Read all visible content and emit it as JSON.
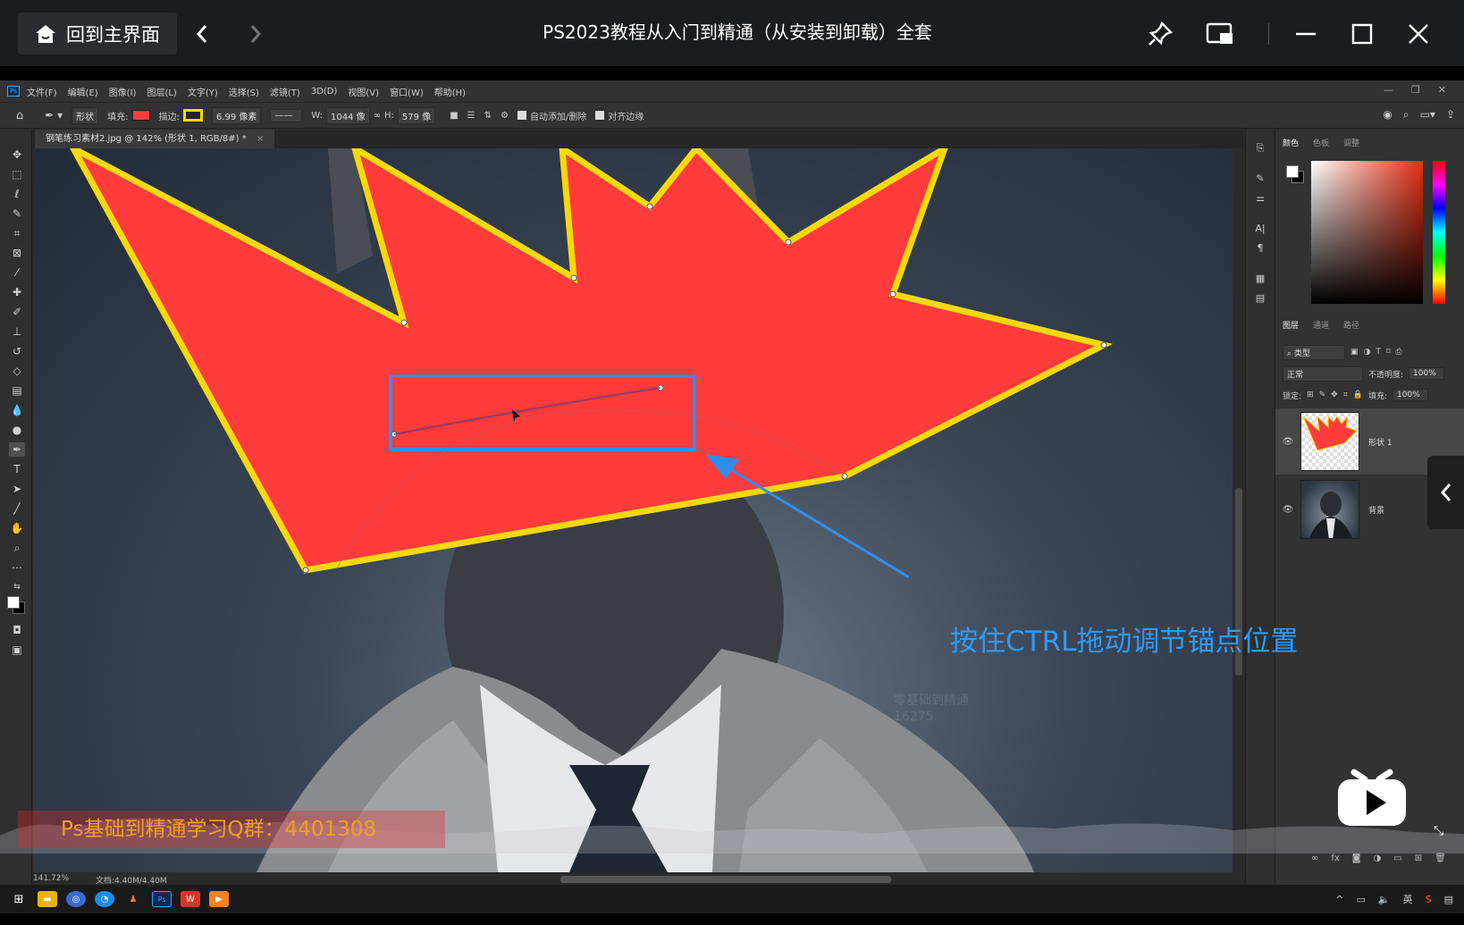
{
  "player": {
    "home_label": "回到主界面",
    "title": "PS2023教程从入门到精通（从安装到卸载）全套"
  },
  "ps": {
    "menu": [
      "文件(F)",
      "编辑(E)",
      "图像(I)",
      "图层(L)",
      "文字(Y)",
      "选择(S)",
      "滤镜(T)",
      "3D(D)",
      "视图(V)",
      "窗口(W)",
      "帮助(H)"
    ],
    "options": {
      "mode": "形状",
      "fill_label": "填充:",
      "stroke_label": "描边:",
      "stroke_width": "6.99 像素",
      "w_label": "W:",
      "w_value": "1044 像",
      "h_label": "H:",
      "h_value": "579 像",
      "auto_add_label": "自动添加/删除",
      "align_edges_label": "对齐边缘"
    },
    "doc_tab": "钢笔练习素材2.jpg @ 142% (形状 1, RGB/8#) *",
    "status": {
      "zoom": "141.72%",
      "doc": "文档:4.40M/4.40M"
    },
    "color_panel_tabs": [
      "颜色",
      "色板",
      "调整"
    ],
    "layers_panel_tabs": [
      "图层",
      "通道",
      "路径"
    ],
    "layers_panel": {
      "kind_filter": "类型",
      "blend_mode": "正常",
      "opacity_label": "不透明度:",
      "opacity_value": "100%",
      "lock_label": "锁定:",
      "fill_label": "填充:",
      "fill_value": "100%"
    },
    "layers": [
      {
        "name": "形状 1"
      },
      {
        "name": "背景"
      }
    ]
  },
  "overlay": {
    "caption": "按住CTRL拖动调节锚点位置",
    "qq_group": "Ps基础到精通学习Q群：4401308",
    "watermark_line1": "零基础到精通",
    "watermark_line2": "16275"
  },
  "colors": {
    "shape_fill": "#ff3b3b",
    "shape_stroke": "#f5d90a",
    "caption": "#2e9bf5",
    "highlight_box": "#2e8ff0",
    "bili": "#ffffff"
  }
}
